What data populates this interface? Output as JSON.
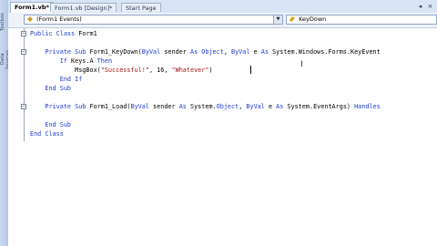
{
  "sidebar": {
    "labels": [
      "Toolbox",
      "Data Sources"
    ]
  },
  "tabs": [
    {
      "label": "Form1.vb*",
      "active": true
    },
    {
      "label": "Form1.vb [Design]*",
      "active": false
    },
    {
      "label": "Start Page",
      "active": false
    }
  ],
  "tab_controls": {
    "scroll_glyph": "◂",
    "close_glyph": "×"
  },
  "dropdowns": {
    "object": "(Form1 Events)",
    "event": "KeyDown"
  },
  "code": {
    "lines": [
      {
        "segments": [
          {
            "t": "Public Class ",
            "kw": true
          },
          {
            "t": "Form1"
          }
        ]
      },
      {
        "segments": []
      },
      {
        "segments": [
          {
            "t": "    Private Sub ",
            "kw": true
          },
          {
            "t": "Form1_KeyDown("
          },
          {
            "t": "ByVal",
            "kw": true
          },
          {
            "t": " sender "
          },
          {
            "t": "As",
            "kw": true
          },
          {
            "t": " "
          },
          {
            "t": "Object",
            "kw": true
          },
          {
            "t": ", "
          },
          {
            "t": "ByVal",
            "kw": true
          },
          {
            "t": " e "
          },
          {
            "t": "As",
            "kw": true
          },
          {
            "t": " System.Windows.Forms.KeyEvent"
          }
        ]
      },
      {
        "segments": [
          {
            "t": "        If",
            "kw": true
          },
          {
            "t": " Keys.A "
          },
          {
            "t": "Then",
            "kw": true
          }
        ]
      },
      {
        "segments": [
          {
            "t": "            MsgBox("
          },
          {
            "t": "\"Successful!\"",
            "str": true
          },
          {
            "t": ", 16, "
          },
          {
            "t": "\"Whatever\"",
            "str": true
          },
          {
            "t": ")"
          }
        ]
      },
      {
        "segments": [
          {
            "t": "        End If",
            "kw": true
          }
        ]
      },
      {
        "segments": [
          {
            "t": "    End Sub",
            "kw": true
          }
        ]
      },
      {
        "segments": []
      },
      {
        "segments": [
          {
            "t": "    Private Sub ",
            "kw": true
          },
          {
            "t": "Form1_Load("
          },
          {
            "t": "ByVal",
            "kw": true
          },
          {
            "t": " sender "
          },
          {
            "t": "As",
            "kw": true
          },
          {
            "t": " System."
          },
          {
            "t": "Object",
            "kw": true
          },
          {
            "t": ", "
          },
          {
            "t": "ByVal",
            "kw": true
          },
          {
            "t": " e "
          },
          {
            "t": "As",
            "kw": true
          },
          {
            "t": " System.EventArgs) "
          },
          {
            "t": "Handles",
            "kw": true
          }
        ]
      },
      {
        "segments": []
      },
      {
        "segments": [
          {
            "t": "    End Sub",
            "kw": true
          }
        ]
      },
      {
        "segments": [
          {
            "t": "End Class",
            "kw": true
          }
        ]
      }
    ]
  },
  "colors": {
    "keyword": "#1f3bd6",
    "string": "#a31515"
  }
}
